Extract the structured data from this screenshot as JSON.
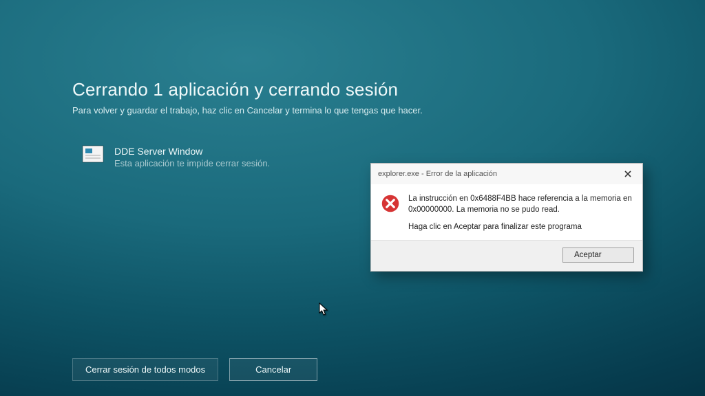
{
  "header": {
    "title": "Cerrando 1 aplicación y cerrando sesión",
    "subtitle": "Para volver y guardar el trabajo, haz clic en Cancelar y termina lo que tengas que hacer."
  },
  "blocking_app": {
    "name": "DDE Server Window",
    "desc": "Esta aplicación te impide cerrar sesión."
  },
  "buttons": {
    "force": "Cerrar sesión de todos modos",
    "cancel": "Cancelar"
  },
  "dialog": {
    "title": "explorer.exe - Error de la aplicación",
    "line1": "La instrucción en 0x6488F4BB hace referencia a la memoria en 0x00000000. La memoria no se pudo read.",
    "line2": "Haga clic en Aceptar para finalizar este programa",
    "ok": "Aceptar"
  }
}
